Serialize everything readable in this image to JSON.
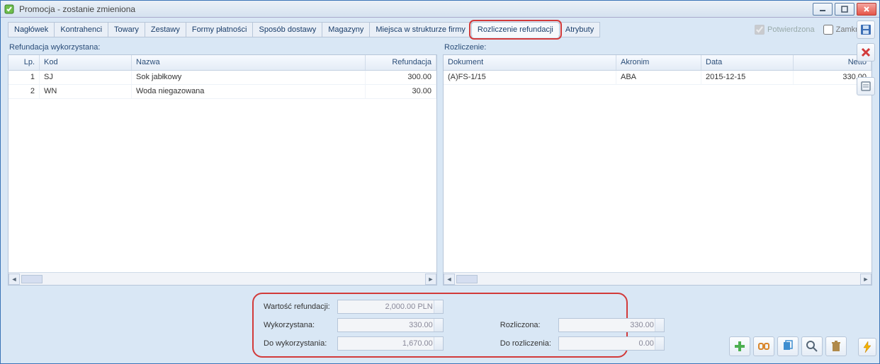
{
  "window": {
    "title": "Promocja - zostanie zmieniona"
  },
  "tabs": [
    "Nagłówek",
    "Kontrahenci",
    "Towary",
    "Zestawy",
    "Formy płatności",
    "Sposób dostawy",
    "Magazyny",
    "Miejsca w strukturze firmy",
    "Rozliczenie refundacji",
    "Atrybuty"
  ],
  "active_tab": 8,
  "checkboxes": {
    "potwierdzona": {
      "label": "Potwierdzona",
      "checked": true,
      "disabled": true
    },
    "zamknieta": {
      "label": "Zamknięta",
      "checked": false,
      "disabled": false
    }
  },
  "left_grid": {
    "title": "Refundacja wykorzystana:",
    "columns": [
      "Lp.",
      "Kod",
      "Nazwa",
      "Refundacja"
    ],
    "rows": [
      {
        "lp": "1",
        "kod": "SJ",
        "nazwa": "Sok jabłkowy",
        "refund": "300.00"
      },
      {
        "lp": "2",
        "kod": "WN",
        "nazwa": "Woda niegazowana",
        "refund": "30.00"
      }
    ]
  },
  "right_grid": {
    "title": "Rozliczenie:",
    "columns": [
      "Dokument",
      "Akronim",
      "Data",
      "Netto"
    ],
    "rows": [
      {
        "dok": "(A)FS-1/15",
        "akr": "ABA",
        "data": "2015-12-15",
        "netto": "330.00"
      }
    ]
  },
  "summary": {
    "wartosc_refund_label": "Wartość refundacji:",
    "wartosc_refund_value": "2,000.00 PLN",
    "wykorzystana_label": "Wykorzystana:",
    "wykorzystana_value": "330.00",
    "do_wykorzystania_label": "Do wykorzystania:",
    "do_wykorzystania_value": "1,670.00",
    "rozliczona_label": "Rozliczona:",
    "rozliczona_value": "330.00",
    "do_rozliczenia_label": "Do rozliczenia:",
    "do_rozliczenia_value": "0.00"
  }
}
